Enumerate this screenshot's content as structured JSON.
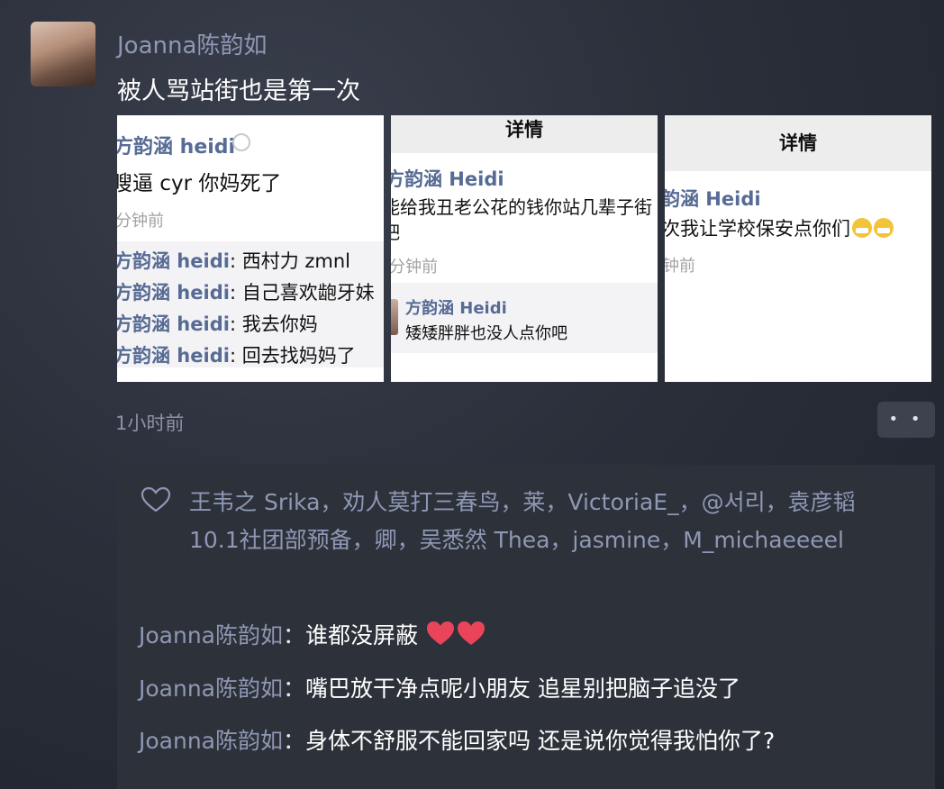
{
  "post": {
    "author": "Joanna陈韵如",
    "text": "被人骂站街也是第一次",
    "time": "1小时前",
    "more_label": "• •"
  },
  "screenshots": [
    {
      "name": "方韵涵 heidi",
      "message": "瞍逼 cyr 你妈死了",
      "time": "分钟前",
      "replies": [
        {
          "name": "方韵涵 heidi",
          "text": ": 西村力 zmnl"
        },
        {
          "name": "方韵涵 heidi",
          "text": ": 自己喜欢龅牙妹"
        },
        {
          "name": "方韵涵 heidi",
          "text": ": 我去你妈"
        },
        {
          "name": "方韵涵 heidi",
          "text": ": 回去找妈妈了"
        }
      ]
    },
    {
      "header": "详情",
      "name": "方韵涵 Heidi",
      "message_line1": "能给我丑老公花的钱你站几辈子街",
      "message_line2": "吧",
      "time": "分钟前",
      "comment_name": "方韵涵 Heidi",
      "comment_text": "矮矮胖胖也没人点你吧"
    },
    {
      "header": "详情",
      "name": "韵涵 Heidi",
      "message": "次我让学校保安点你们",
      "time": "钟前"
    }
  ],
  "likes": {
    "line1": "王韦之 Srika，劝人莫打三春鸟，莱，VictoriaE_，@서리，袁彦韬",
    "line2": "10.1社团部预备，卿，吴悉然 Thea，jasmine，M_michaeeeel"
  },
  "comments": [
    {
      "author": "Joanna陈韵如",
      "sep": "：",
      "text": "谁都没屏蔽"
    },
    {
      "author": "Joanna陈韵如",
      "sep": "：",
      "text": "嘴巴放干净点呢小朋友 追星别把脑子追没了"
    },
    {
      "author": "Joanna陈韵如",
      "sep": "：",
      "text": "身体不舒服不能回家吗 还是说你觉得我怕你了?"
    }
  ],
  "colors": {
    "name_link": "#8e98b4",
    "background": "#2b2f3a",
    "comment_panel": "#2d313a",
    "heart": "#e9445a"
  }
}
